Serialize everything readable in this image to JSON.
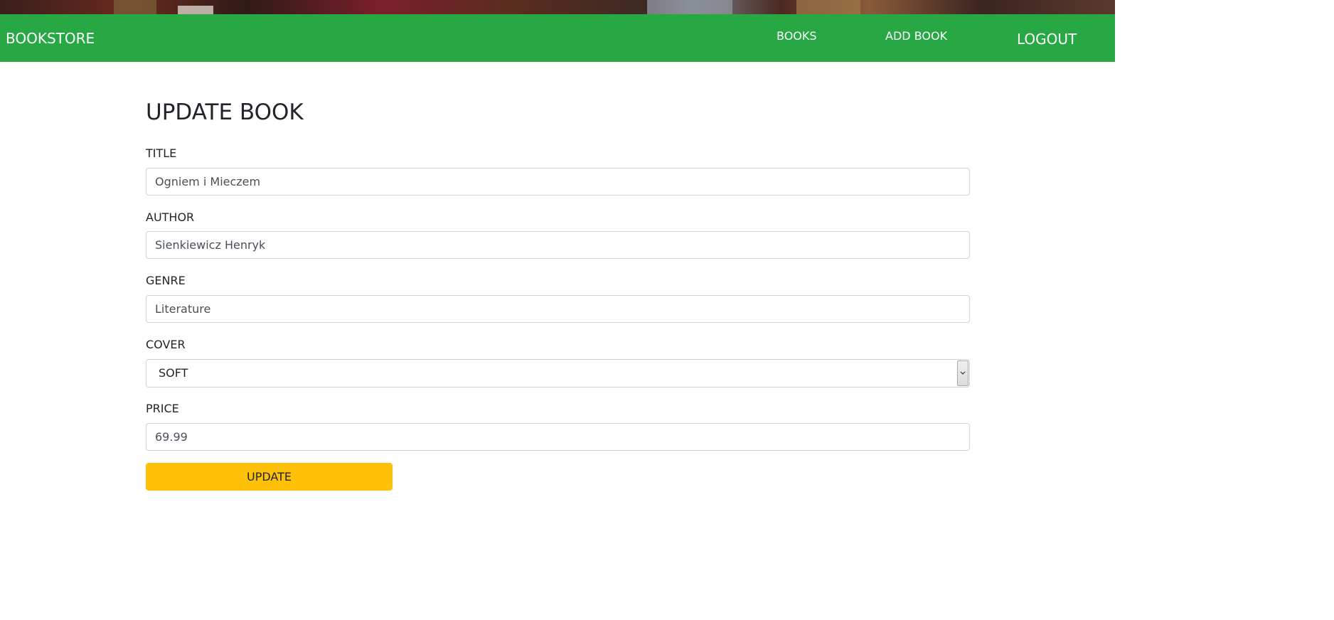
{
  "navbar": {
    "brand": "BOOKSTORE",
    "links": {
      "books": "BOOKS",
      "add_book": "ADD BOOK",
      "logout": "LOGOUT"
    },
    "color": "#28a745"
  },
  "page": {
    "title": "UPDATE BOOK"
  },
  "form": {
    "title": {
      "label": "TITLE",
      "value": "Ogniem i Mieczem"
    },
    "author": {
      "label": "AUTHOR",
      "value": "Sienkiewicz Henryk"
    },
    "genre": {
      "label": "GENRE",
      "value": "Literature"
    },
    "cover": {
      "label": "COVER",
      "selected": "SOFT"
    },
    "price": {
      "label": "PRICE",
      "value": "69.99"
    },
    "submit_label": "UPDATE",
    "submit_color": "#ffc107"
  }
}
